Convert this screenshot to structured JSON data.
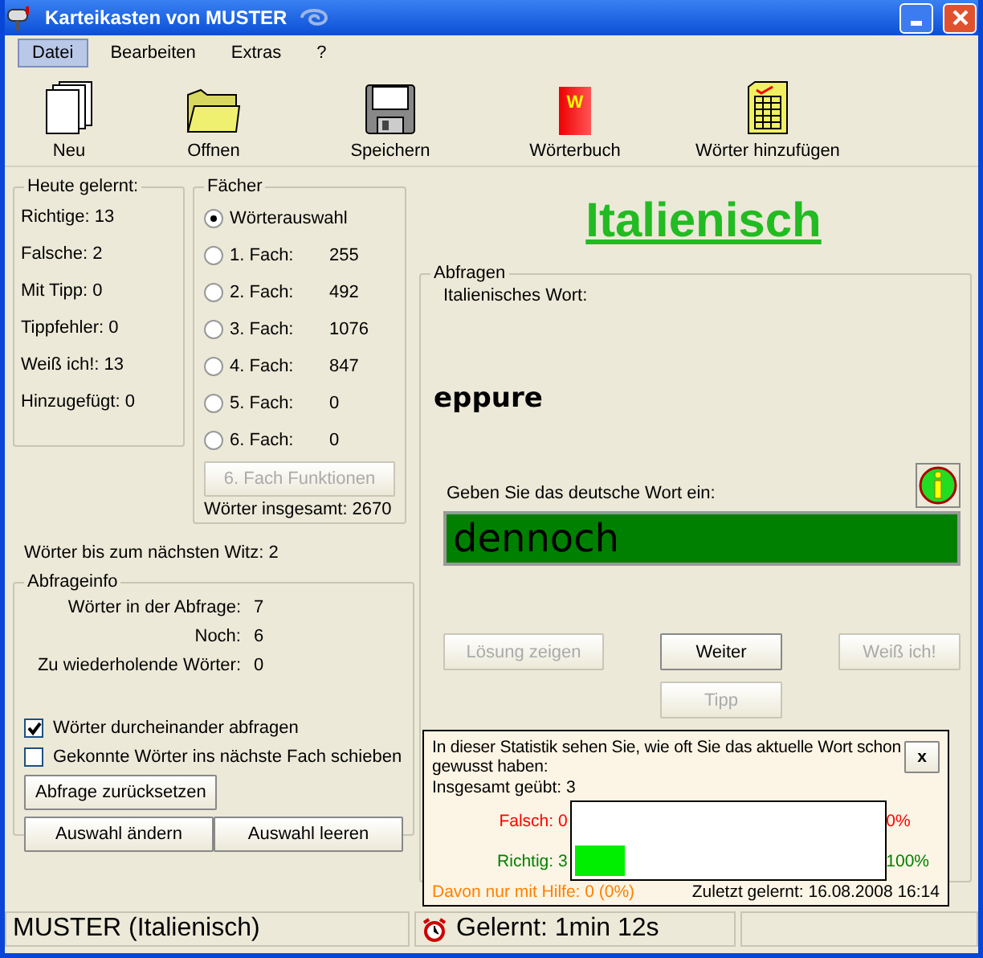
{
  "window": {
    "title": "Karteikasten von MUSTER"
  },
  "menu": [
    {
      "label": "Datei",
      "selected": true
    },
    {
      "label": "Bearbeiten",
      "selected": false
    },
    {
      "label": "Extras",
      "selected": false
    },
    {
      "label": "?",
      "selected": false
    }
  ],
  "toolbar": [
    {
      "kind": "new",
      "label": "Neu"
    },
    {
      "kind": "open",
      "label": "Offnen"
    },
    {
      "kind": "save",
      "label": "Speichern"
    },
    {
      "kind": "dictionary",
      "label": "Wörterbuch",
      "badge": "W"
    },
    {
      "kind": "add",
      "label": "Wörter hinzufügen"
    }
  ],
  "today": {
    "title": "Heute gelernt:",
    "items": [
      "Richtige: 13",
      "Falsche: 2",
      "Mit Tipp: 0",
      "Tippfehler: 0",
      "Weiß ich!: 13",
      "Hinzugefügt: 0"
    ]
  },
  "compartments": {
    "title": "Fächer",
    "options": [
      {
        "label": "Wörterauswahl",
        "selected": true
      },
      {
        "label": "1. Fach:",
        "count": "255",
        "selected": false
      },
      {
        "label": "2. Fach:",
        "count": "492",
        "selected": false
      },
      {
        "label": "3. Fach:",
        "count": "1076",
        "selected": false
      },
      {
        "label": "4. Fach:",
        "count": "847",
        "selected": false
      },
      {
        "label": "5. Fach:",
        "count": "0",
        "selected": false
      },
      {
        "label": "6. Fach:",
        "count": "0",
        "selected": false
      }
    ],
    "button": {
      "label": "6. Fach Funktionen",
      "disabled": true
    },
    "total": "Wörter insgesamt: 2670"
  },
  "joke_counter": "Wörter bis zum nächsten Witz: 2",
  "query_info": {
    "title": "Abfrageinfo",
    "rows": [
      {
        "label": "Wörter in der Abfrage:",
        "value": "7"
      },
      {
        "label": "Noch:",
        "value": "6"
      },
      {
        "label": "Zu wiederholende Wörter:",
        "value": "0"
      }
    ],
    "checkboxes": [
      {
        "label": "Wörter durcheinander abfragen",
        "checked": true
      },
      {
        "label": "Gekonnte Wörter ins nächste Fach schieben",
        "checked": false
      }
    ],
    "buttons": [
      "Abfrage zurücksetzen",
      "Auswahl ändern",
      "Auswahl leeren"
    ]
  },
  "language": "Italienisch",
  "query": {
    "title": "Abfragen",
    "word_label": "Italienisches Wort:",
    "word": "eppure",
    "answer_label": "Geben Sie das deutsche Wort ein:",
    "answer": "dennoch",
    "answer_correct": true,
    "buttons": [
      {
        "label": "Lösung zeigen",
        "disabled": true
      },
      {
        "label": "Weiter",
        "disabled": false
      },
      {
        "label": "Weiß ich!",
        "disabled": true
      },
      {
        "label": "Tipp",
        "disabled": true
      }
    ]
  },
  "stats": {
    "text": "In dieser Statistik sehen Sie, wie oft Sie das aktuelle Wort schon gewusst haben:",
    "close": "x",
    "total": "Insgesamt geübt: 3",
    "rows": [
      {
        "label": "Falsch: 0",
        "percent": "0%",
        "color": "#ff0000"
      },
      {
        "label": "Richtig: 3",
        "percent": "100%",
        "level": 0.16,
        "color": "#008000"
      }
    ],
    "help": "Davon nur mit Hilfe: 0 (0%)",
    "last": "Zuletzt gelernt: 16.08.2008 16:14"
  },
  "status_bar": [
    {
      "kind": "plain",
      "text": "MUSTER (Italienisch)"
    },
    {
      "kind": "timer",
      "text": "Gelernt: 1min 12s"
    }
  ]
}
